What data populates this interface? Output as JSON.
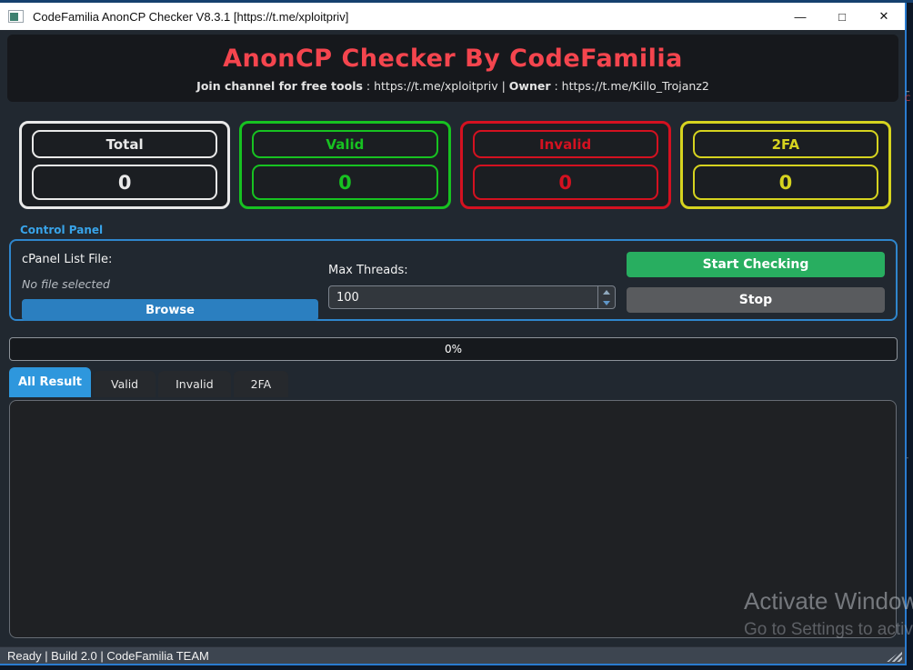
{
  "titlebar": {
    "title": "CodeFamilia AnonCP Checker V8.3.1 [https://t.me/xploitpriv]",
    "minimize_glyph": "—",
    "maximize_glyph": "□",
    "close_glyph": "✕"
  },
  "header": {
    "title": "AnonCP Checker By CodeFamilia",
    "subtitle_bold_1": "Join channel for free tools",
    "subtitle_text_1": " : https://t.me/xploitpriv | ",
    "subtitle_bold_2": "Owner",
    "subtitle_text_2": " : https://t.me/Killo_Trojanz2"
  },
  "counters": [
    {
      "label": "Total",
      "value": "0",
      "color": "#e9e9e9"
    },
    {
      "label": "Valid",
      "value": "0",
      "color": "#17c221"
    },
    {
      "label": "Invalid",
      "value": "0",
      "color": "#d41120"
    },
    {
      "label": "2FA",
      "value": "0",
      "color": "#d6d31f"
    }
  ],
  "control_panel": {
    "group_label": "Control Panel",
    "file_label": "cPanel List File:",
    "file_status": "No file selected",
    "browse_label": "Browse",
    "threads_label": "Max Threads:",
    "threads_value": "100",
    "start_label": "Start Checking",
    "stop_label": "Stop"
  },
  "progress": {
    "label": "0%"
  },
  "tabs": [
    {
      "label": "All Result",
      "active": true
    },
    {
      "label": "Valid",
      "active": false
    },
    {
      "label": "Invalid",
      "active": false
    },
    {
      "label": "2FA",
      "active": false
    }
  ],
  "watermark": {
    "line1": "Activate Windows",
    "line2": "Go to Settings to activate Windows."
  },
  "statusbar": {
    "text": "Ready | Build 2.0 | CodeFamilia TEAM"
  },
  "colors": {
    "accent_blue": "#2e93d8",
    "groupbox_border": "#2f86cc",
    "button_green": "#28ae60",
    "button_gray": "#595b5e",
    "title_red": "#f4454e",
    "window_border_blue": "#2a7cd0",
    "app_background": "#212830"
  }
}
